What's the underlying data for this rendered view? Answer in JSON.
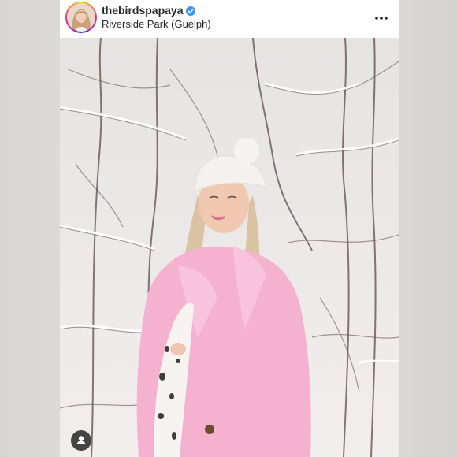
{
  "post": {
    "username": "thebirdspapaya",
    "verified": true,
    "location": "Riverside Park (Guelph)",
    "beanie_text": "",
    "icons": {
      "verified": "verified-badge-icon",
      "more": "more-options-icon",
      "user_tag": "person-icon"
    },
    "colors": {
      "verified_blue": "#3897f0",
      "coat_pink": "#f4b2cf",
      "text": "#262626"
    }
  }
}
